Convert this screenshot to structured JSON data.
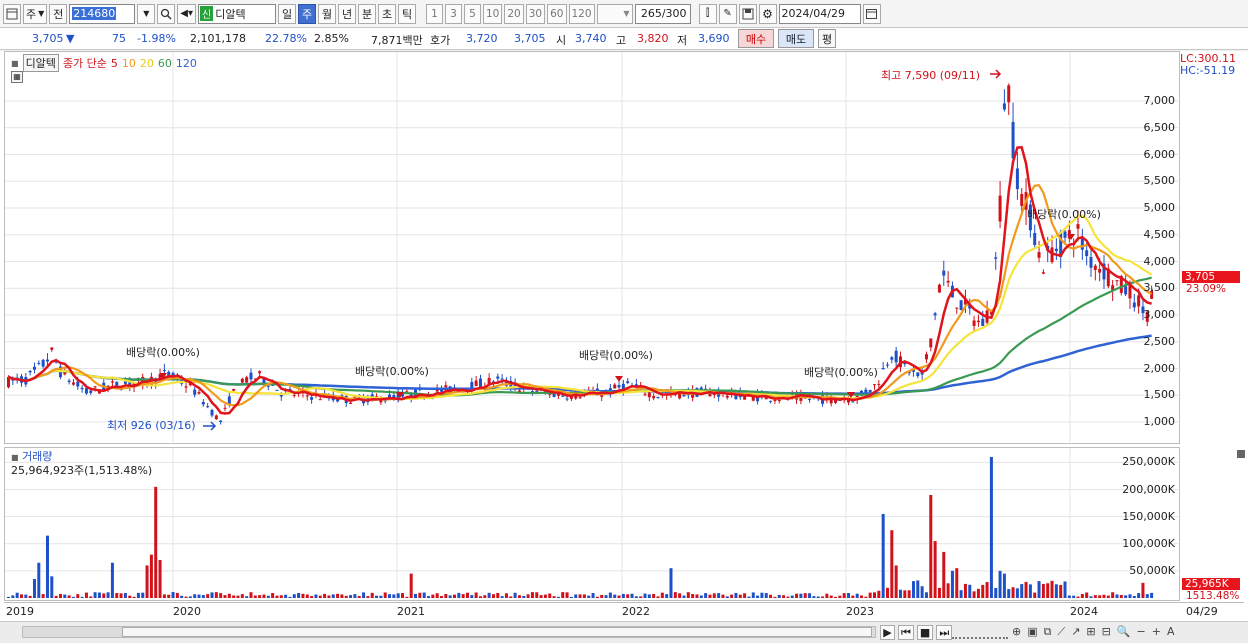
{
  "toolbar": {
    "chart_kind_label": "주",
    "prev_label": "전",
    "code": "214680",
    "stock_name": "디알텍",
    "new_badge": "신",
    "period_buttons": [
      "일",
      "주",
      "월",
      "년",
      "분",
      "초",
      "틱"
    ],
    "active_period": "주",
    "interval_buttons": [
      "1",
      "3",
      "5",
      "10",
      "20",
      "30",
      "60",
      "120"
    ],
    "count_value": "265",
    "count_total": "/300",
    "date_value": "2024/04/29"
  },
  "quote": {
    "price": "3,705",
    "change_arrow": "▼",
    "change": "75",
    "change_pct": "-1.98%",
    "volume": "2,101,178",
    "volume_ratio": "22.78%",
    "turnover": "2.85%",
    "amount": "7,871백만",
    "ask_label": "호가",
    "ask_price": "3,720",
    "bid_price": "3,705",
    "open_label": "시",
    "open": "3,740",
    "high_label": "고",
    "high": "3,820",
    "low_label": "저",
    "low": "3,690",
    "buy_label": "매수",
    "sell_label": "매도",
    "eval_label": "평"
  },
  "legend": {
    "name": "디알텍",
    "ma_prefix": "종가 단순",
    "ma_periods": [
      "5",
      "10",
      "20",
      "60",
      "120"
    ]
  },
  "annotations": {
    "max_label": "최고 7,590 (09/11)",
    "min_label": "최저 926 (03/16)",
    "dividend_labels": [
      "배당락(0.00%)",
      "배당락(0.00%)",
      "배당락(0.00%)",
      "배당락(0.00%)",
      "배당락(0.00%)"
    ]
  },
  "right_info": {
    "lc": "LC:300.11",
    "hc": "HC:-51.19",
    "price_tag": "3,705",
    "price_pct": "23.09%",
    "vol_tag": "25,965K",
    "vol_pct": "1513.48%"
  },
  "price_axis": [
    "7,000",
    "6,500",
    "6,000",
    "5,500",
    "5,000",
    "4,500",
    "4,000",
    "3,500",
    "3,000",
    "2,500",
    "2,000",
    "1,500",
    "1,000"
  ],
  "volume_legend": {
    "title": "거래량",
    "value": "25,964,923주(1,513.48%)"
  },
  "volume_axis": [
    "250,000K",
    "200,000K",
    "150,000K",
    "100,000K",
    "50,000K"
  ],
  "date_axis": [
    "2019",
    "2020",
    "2021",
    "2022",
    "2023",
    "2024",
    "04/29"
  ],
  "colors": {
    "up": "#d0121b",
    "down": "#1e50c8",
    "ma5": "#e0141c",
    "ma10": "#f19a1c",
    "ma20": "#f6e43a",
    "ma60": "#3a9a52",
    "ma120": "#2f62d4"
  }
}
